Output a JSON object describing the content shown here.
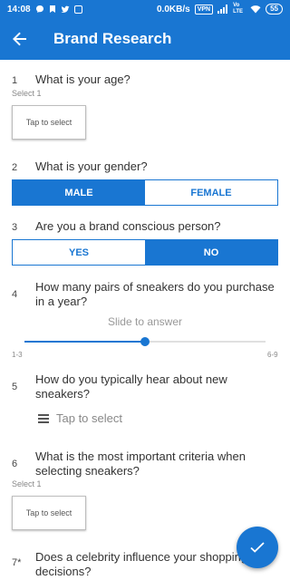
{
  "status": {
    "time": "14:08",
    "net_speed": "0.0KB/s",
    "vpn": "VPN",
    "network": "Vo LTE",
    "battery": "55"
  },
  "appbar": {
    "title": "Brand Research"
  },
  "questions": [
    {
      "num": "1",
      "text": "What is your age?",
      "hint": "Select 1",
      "tap_label": "Tap to select"
    },
    {
      "num": "2",
      "text": "What is your gender?",
      "options": [
        "MALE",
        "FEMALE"
      ],
      "selected": "MALE"
    },
    {
      "num": "3",
      "text": "Are you a brand conscious person?",
      "options": [
        "YES",
        "NO"
      ],
      "selected": "NO"
    },
    {
      "num": "4",
      "text": "How many pairs of sneakers do you purchase in a year?",
      "slider_hint": "Slide to answer",
      "range_min": "1-3",
      "range_max": "6-9",
      "slider_value": 0.5
    },
    {
      "num": "5",
      "text": "How do you typically hear about new sneakers?",
      "tap_label": "Tap to select"
    },
    {
      "num": "6",
      "text": "What is the most important criteria when selecting sneakers?",
      "hint": "Select 1",
      "tap_label": "Tap to select"
    },
    {
      "num": "7*",
      "text": "Does a celebrity influence your shopping decisions?"
    }
  ],
  "icons": {
    "back": "arrow-left-icon",
    "submit": "check-icon",
    "list": "list-lines-icon"
  },
  "colors": {
    "primary": "#1976d2",
    "background": "#ffffff"
  }
}
